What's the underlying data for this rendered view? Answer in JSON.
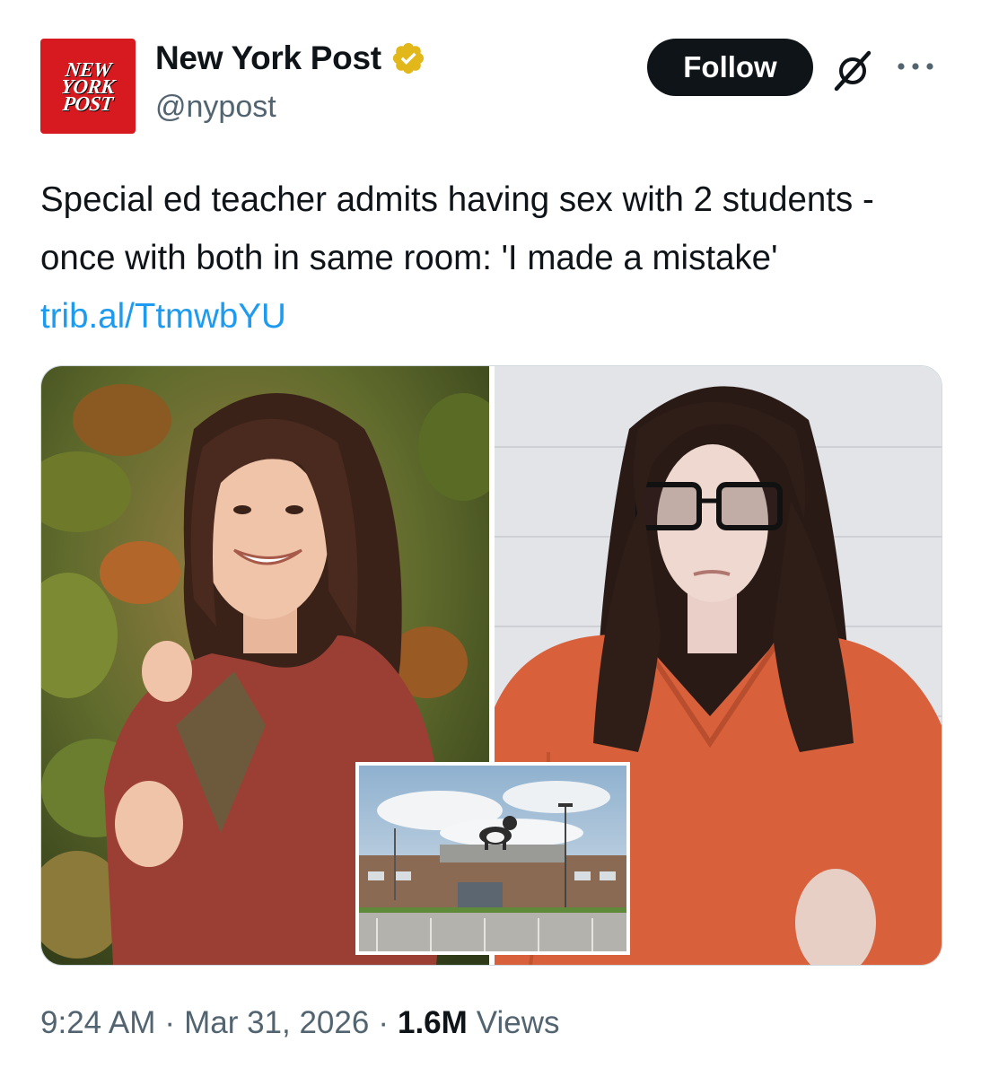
{
  "account": {
    "logo_lines": [
      "NEW",
      "YORK",
      "POST"
    ],
    "display_name": "New York Post",
    "handle": "@nypost",
    "verified_icon": "verified-badge-gold"
  },
  "actions": {
    "follow_label": "Follow",
    "grok_icon": "grok-icon",
    "more_icon": "more-icon"
  },
  "tweet": {
    "text": "Special ed teacher admits having sex with 2 students - once with both in same room: 'I made a mistake' ",
    "link": "trib.al/TtmwbYU"
  },
  "meta": {
    "time": "9:24 AM",
    "separator": "·",
    "date": "Mar 31, 2026",
    "views_count": "1.6M",
    "views_label": "Views"
  },
  "colors": {
    "brand_red": "#d71920",
    "link_blue": "#1d9bf0",
    "muted": "#536471",
    "verified_gold": "#e2b719"
  }
}
